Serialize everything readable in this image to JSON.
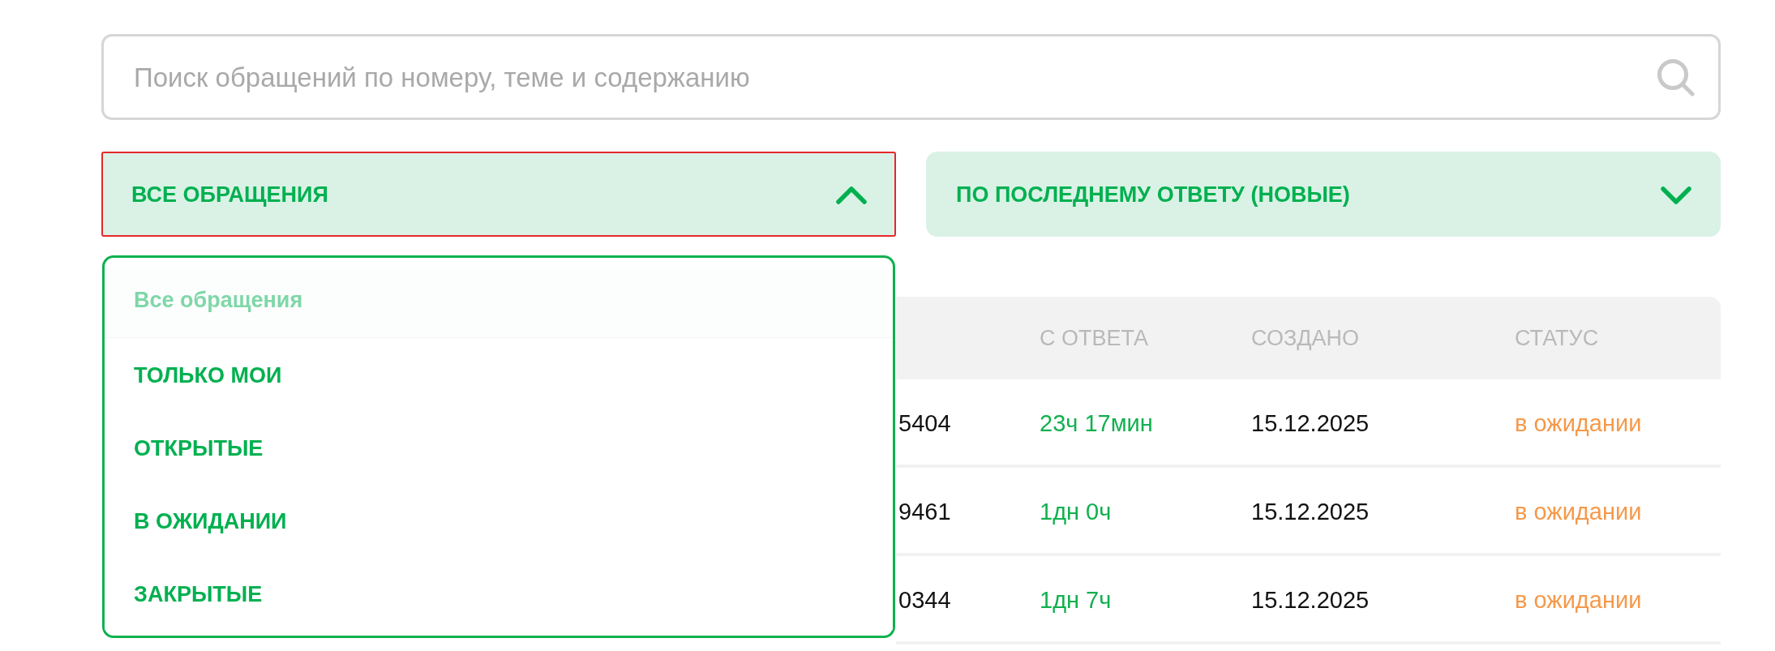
{
  "search": {
    "placeholder": "Поиск обращений по номеру, теме и содержанию"
  },
  "filters": [
    {
      "label": "ВСЕ ОБРАЩЕНИЯ",
      "expanded": true,
      "options": [
        {
          "label": "Все обращения",
          "selected": true
        },
        {
          "label": "ТОЛЬКО МОИ",
          "selected": false
        },
        {
          "label": "ОТКРЫТЫЕ",
          "selected": false
        },
        {
          "label": "В ОЖИДАНИИ",
          "selected": false
        },
        {
          "label": "ЗАКРЫТЫЕ",
          "selected": false
        }
      ]
    },
    {
      "label": "ПО ПОСЛЕДНЕМУ ОТВЕТУ (НОВЫЕ)",
      "expanded": false
    }
  ],
  "table": {
    "columns": [
      "С ОТВЕТА",
      "СОЗДАНО",
      "СТАТУС"
    ],
    "rows": [
      {
        "column_1": "5404",
        "since_reply": "23ч 17мин",
        "created": "15.12.2025",
        "status": "в ожидании"
      },
      {
        "column_1": "9461",
        "since_reply": "1дн 0ч",
        "created": "15.12.2025",
        "status": "в ожидании"
      },
      {
        "column_1": "0344",
        "since_reply": "1дн 7ч",
        "created": "15.12.2025",
        "status": "в ожидании"
      }
    ]
  }
}
